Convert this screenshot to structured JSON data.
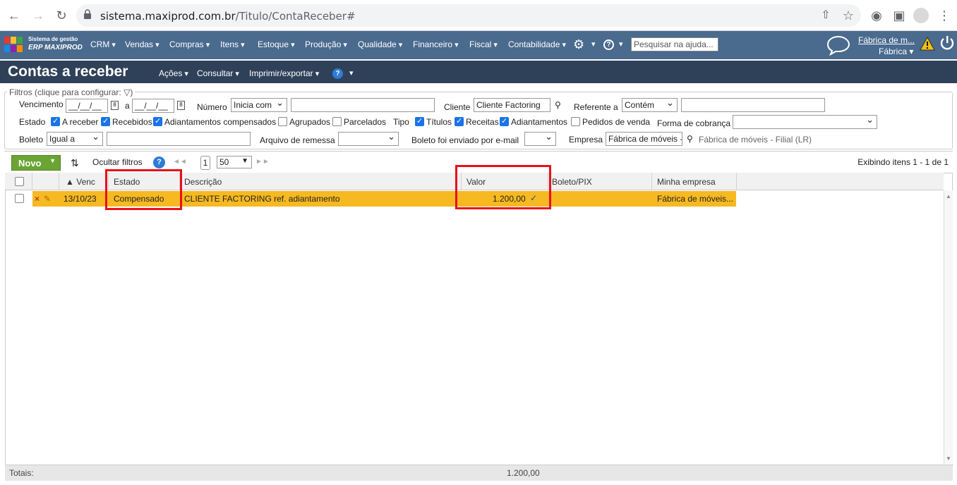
{
  "browser": {
    "url_host": "sistema.maxiprod.com.br",
    "url_path": "/Titulo/ContaReceber#"
  },
  "app": {
    "brand_line1": "Sistema de gestão",
    "brand_line2": "ERP MAXIPROD",
    "nav": [
      "CRM",
      "Vendas",
      "Compras",
      "Itens",
      "Estoque",
      "Produção",
      "Qualidade",
      "Financeiro",
      "Fiscal",
      "Contabilidade"
    ],
    "help_search_placeholder": "Pesquisar na ajuda...",
    "company_link": "Fábrica de m...",
    "company_unit": "Fábrica"
  },
  "page": {
    "title": "Contas a receber",
    "menus": [
      "Ações",
      "Consultar",
      "Imprimir/exportar"
    ]
  },
  "filters": {
    "legend": "Filtros (clique para configurar:",
    "vencimento_label": "Vencimento",
    "date_placeholder": "__/__/__",
    "a_label": "a",
    "numero_label": "Número",
    "numero_op": "Inicia com",
    "cliente_label": "Cliente",
    "cliente_value": "Cliente Factoring",
    "referente_label": "Referente a",
    "referente_op": "Contém",
    "estado_label": "Estado",
    "estado_options": [
      {
        "label": "A receber",
        "checked": true
      },
      {
        "label": "Recebidos",
        "checked": true
      },
      {
        "label": "Adiantamentos compensados",
        "checked": true
      },
      {
        "label": "Agrupados",
        "checked": false
      },
      {
        "label": "Parcelados",
        "checked": false
      }
    ],
    "tipo_label": "Tipo",
    "tipo_options": [
      {
        "label": "Títulos",
        "checked": true
      },
      {
        "label": "Receitas",
        "checked": true
      },
      {
        "label": "Adiantamentos",
        "checked": true
      },
      {
        "label": "Pedidos de venda",
        "checked": false
      }
    ],
    "forma_cobranca_label": "Forma de cobrança",
    "boleto_label": "Boleto",
    "boleto_op": "Igual a",
    "arquivo_label": "Arquivo de remessa",
    "enviado_label": "Boleto foi enviado por e-mail",
    "empresa_label": "Empresa",
    "empresa_value": "Fábrica de móveis -",
    "empresa_desc": "Fábrica de móveis - Filial (LR)"
  },
  "toolbar": {
    "novo": "Novo",
    "ocultar": "Ocultar filtros",
    "page": "1",
    "page_size": "50",
    "exibindo": "Exibindo itens 1 - 1 de 1"
  },
  "grid": {
    "headers": {
      "venc": "Venc",
      "estado": "Estado",
      "descricao": "Descrição",
      "valor": "Valor",
      "boleto": "Boleto/PIX",
      "empresa": "Minha empresa"
    },
    "row": {
      "venc": "13/10/23",
      "estado": "Compensado",
      "descricao": "CLIENTE FACTORING ref. adiantamento",
      "valor": "1.200,00",
      "empresa": "Fábrica de móveis..."
    },
    "totals_label": "Totais:",
    "total_valor": "1.200,00"
  },
  "colors": {
    "nav": "#4a6a8e",
    "title": "#2f4159",
    "row_highlight": "#f6b921",
    "novo": "#6aa534",
    "annotation": "#e8101a"
  }
}
